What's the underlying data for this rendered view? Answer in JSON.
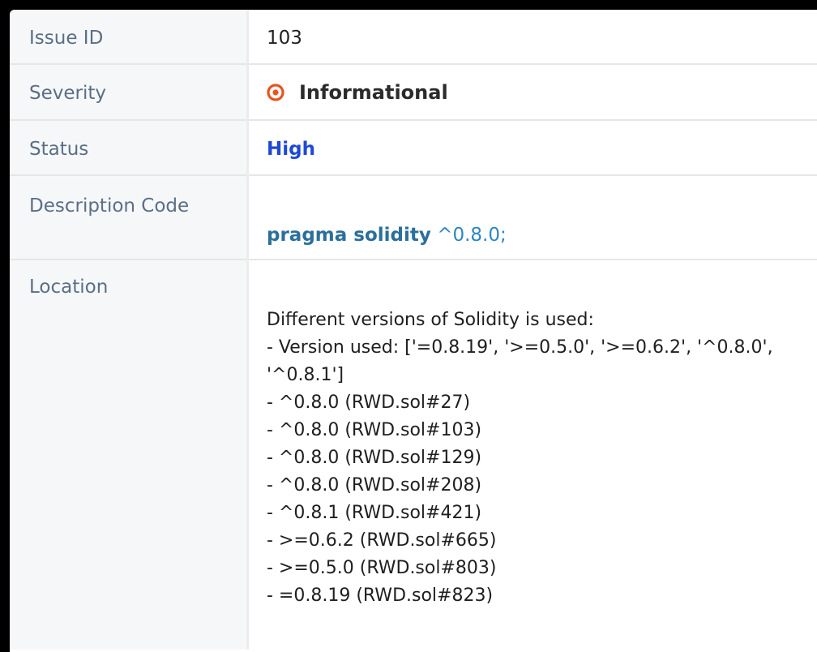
{
  "rows": {
    "issue_id": {
      "label": "Issue ID",
      "value": "103"
    },
    "severity": {
      "label": "Severity",
      "value": "Informational",
      "icon": "target-circle-icon",
      "icon_color": "#e8531f"
    },
    "status": {
      "label": "Status",
      "value": "High",
      "color": "#1d49d6"
    },
    "description_code": {
      "label": "Description Code",
      "keyword": "pragma solidity",
      "version": "^0.8.0;"
    },
    "location": {
      "label": "Location",
      "lines": [
        "Different versions of Solidity is used:",
        "- Version used: ['=0.8.19', '>=0.5.0', '>=0.6.2', '^0.8.0',",
        "'^0.8.1']",
        "- ^0.8.0 (RWD.sol#27)",
        "- ^0.8.0 (RWD.sol#103)",
        "- ^0.8.0 (RWD.sol#129)",
        "- ^0.8.0 (RWD.sol#208)",
        "- ^0.8.1 (RWD.sol#421)",
        "- >=0.6.2 (RWD.sol#665)",
        "- >=0.5.0 (RWD.sol#803)",
        "- =0.8.19 (RWD.sol#823)"
      ]
    }
  }
}
